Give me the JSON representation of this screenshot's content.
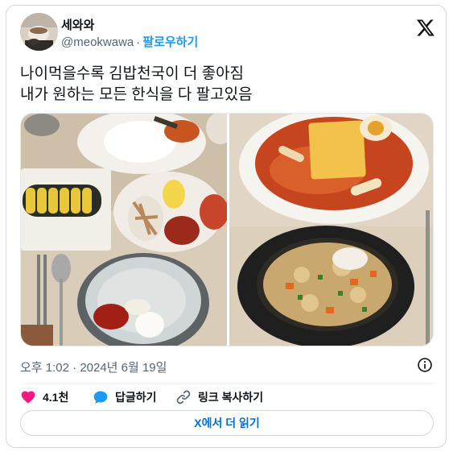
{
  "user": {
    "display_name": "세와와",
    "handle": "@meokwawa",
    "separator": "·",
    "follow_label": "팔로우하기"
  },
  "tweet": {
    "line1": "나이먹을수록 김밥천국이 더 좋아짐",
    "line2": "내가 원하는 모든 한식을 다 팔고있음"
  },
  "media": {
    "photo1": "gimbap-naengmyeon-tray-icon",
    "photo2": "tteokbokki-fried-rice-icon"
  },
  "meta": {
    "time": "오후 1:02",
    "separator": "·",
    "date": "2024년 6월 19일"
  },
  "actions": {
    "like_count": "4.1천",
    "reply_label": "답글하기",
    "copy_link_label": "링크 복사하기"
  },
  "read_more_label": "X에서 더 읽기",
  "colors": {
    "accent": "#1d9bf0",
    "link": "#006fd6",
    "like": "#f91880",
    "muted": "#536471",
    "border": "#cfd9de"
  }
}
